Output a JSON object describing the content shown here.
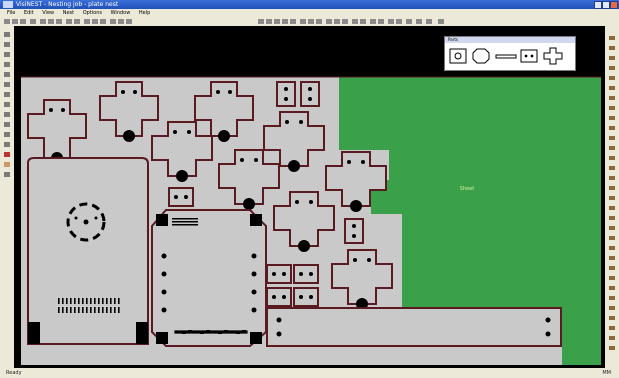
{
  "window": {
    "title": "VisiNEST - Nesting job - plate nest"
  },
  "menu": [
    "File",
    "Edit",
    "View",
    "Nest",
    "Options",
    "Window",
    "Help"
  ],
  "palette": {
    "title": "Parts",
    "items": [
      "part-a-icon",
      "part-b-icon",
      "part-c-icon",
      "part-d-icon",
      "part-e-icon"
    ]
  },
  "sheet": {
    "label": "Sheet"
  },
  "status": {
    "left": "Ready",
    "right": "MM"
  },
  "colors": {
    "sheet": "#3aa14a",
    "scrap": "#c9c9c9",
    "outline": "#5a1a22",
    "canvas": "#000000"
  }
}
